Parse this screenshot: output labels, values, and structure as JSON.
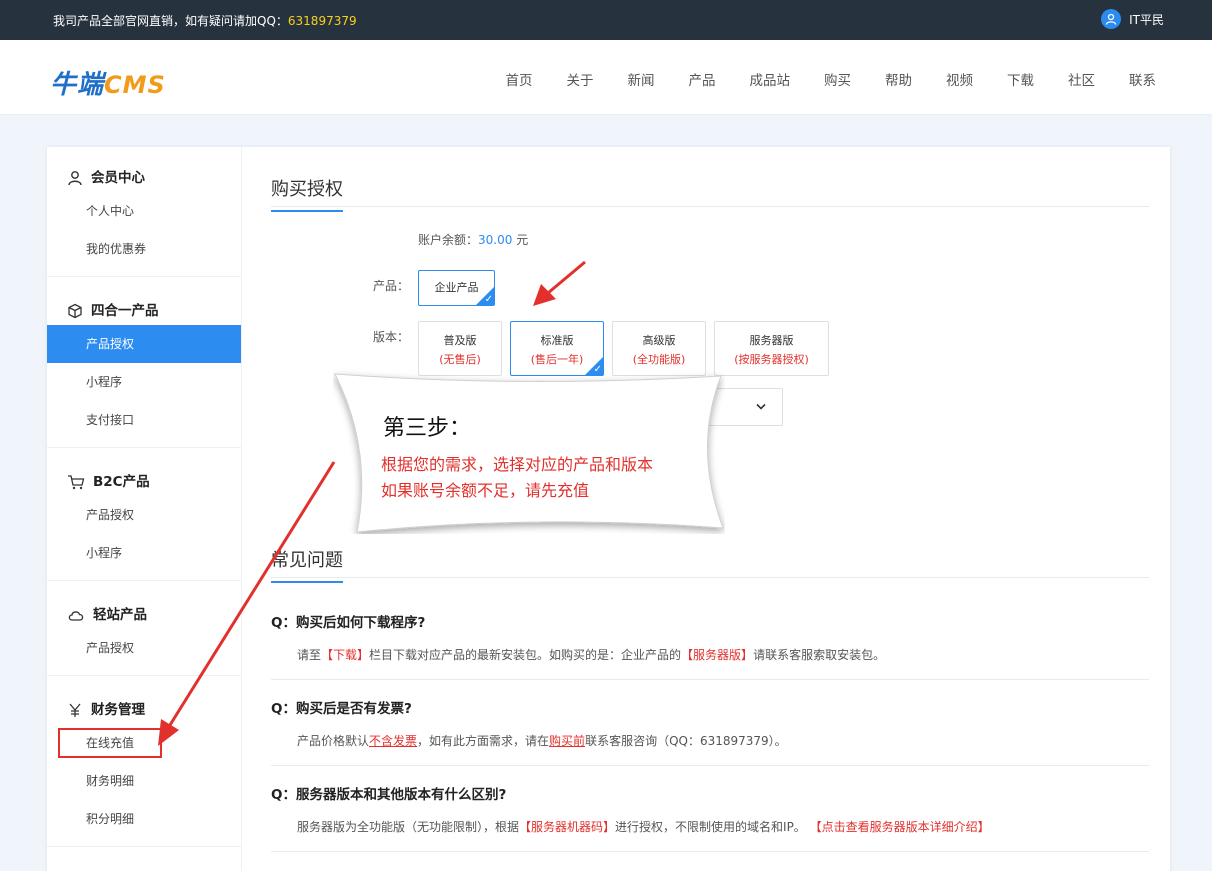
{
  "topbar": {
    "notice_prefix": "我司产品全部官网直销，如有疑问请加QQ：",
    "qq": "631897379",
    "username": "IT平民"
  },
  "logo": {
    "part1": "牛端",
    "part2": "CMS"
  },
  "nav": [
    "首页",
    "关于",
    "新闻",
    "产品",
    "成品站",
    "购买",
    "帮助",
    "视频",
    "下载",
    "社区",
    "联系"
  ],
  "sidebar": {
    "sections": [
      {
        "title": "会员中心",
        "items": [
          "个人中心",
          "我的优惠券"
        ]
      },
      {
        "title": "四合一产品",
        "items": [
          "产品授权",
          "小程序",
          "支付接口"
        ]
      },
      {
        "title": "B2C产品",
        "items": [
          "产品授权",
          "小程序"
        ]
      },
      {
        "title": "轻站产品",
        "items": [
          "产品授权"
        ]
      },
      {
        "title": "财务管理",
        "items": [
          "在线充值",
          "财务明细",
          "积分明细"
        ]
      }
    ]
  },
  "purchase": {
    "title": "购买授权",
    "balance_label": "账户余额：",
    "balance_value": "30.00",
    "balance_unit": "元",
    "product_label": "产品：",
    "product_option": "企业产品",
    "edition_label": "版本：",
    "editions": [
      {
        "name": "普及版",
        "sub": "(无售后)"
      },
      {
        "name": "标准版",
        "sub": "(售后一年)"
      },
      {
        "name": "高级版",
        "sub": "(全功能版)"
      },
      {
        "name": "服务器版",
        "sub": "(按服务器授权)"
      }
    ],
    "select_icon": "chevron-down-icon"
  },
  "callout": {
    "title": "第三步：",
    "line1": "根据您的需求，选择对应的产品和版本",
    "line2": "如果账号余额不足，请先充值"
  },
  "faq": {
    "title": "常见问题",
    "q_prefix": "Q：",
    "items": [
      {
        "q": "购买后如何下载程序?",
        "a": [
          "请至",
          "【下载】",
          "栏目下载对应产品的最新安装包。如购买的是：企业产品的",
          "【服务器版】",
          "请联系客服索取安装包。"
        ]
      },
      {
        "q": "购买后是否有发票?",
        "a": [
          "产品价格默认",
          "不含发票",
          "，如有此方面需求，请在",
          "购买前",
          "联系客服咨询（QQ：631897379）。"
        ]
      },
      {
        "q": "服务器版本和其他版本有什么区别?",
        "a": [
          "服务器版为全功能版（无功能限制），根据",
          "【服务器机器码】",
          "进行授权，不限制使用的域名和IP。",
          "【点击查看服务器版本详细介绍】"
        ]
      }
    ]
  },
  "colors": {
    "accent": "#2d8cf0",
    "annotation_red": "#e2302c",
    "topbar": "#27323f"
  }
}
